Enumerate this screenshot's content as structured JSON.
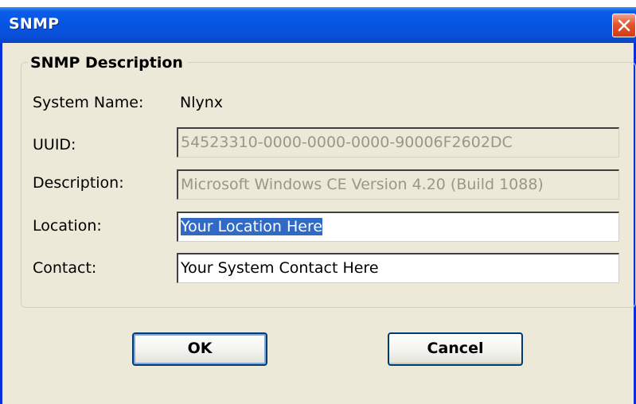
{
  "window": {
    "title": "SNMP",
    "close_icon": "close-icon"
  },
  "group": {
    "title": "SNMP Description"
  },
  "fields": {
    "system_name": {
      "label": "System Name:",
      "value": "Nlynx"
    },
    "uuid": {
      "label": "UUID:",
      "value": "54523310-0000-0000-0000-90006F2602DC"
    },
    "description": {
      "label": "Description:",
      "value": "Microsoft Windows CE Version 4.20 (Build 1088)"
    },
    "location": {
      "label": "Location:",
      "value": "Your Location Here"
    },
    "contact": {
      "label": "Contact:",
      "value": "Your System Contact Here"
    }
  },
  "buttons": {
    "ok": "OK",
    "cancel": "Cancel"
  },
  "colors": {
    "titlebar": "#0554e3",
    "window_bg": "#ece9d8",
    "selection": "#316ac5",
    "close_button": "#d13a13"
  }
}
